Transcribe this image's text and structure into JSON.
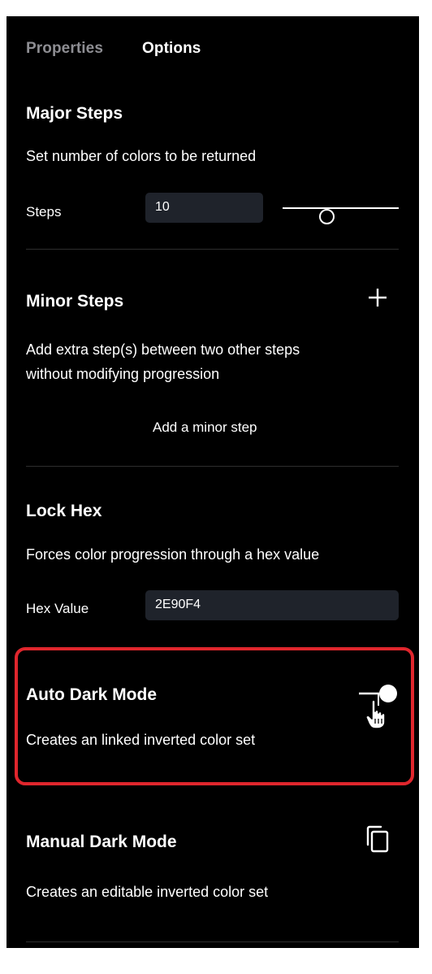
{
  "tabs": [
    {
      "label": "Properties",
      "active": false
    },
    {
      "label": "Options",
      "active": true
    }
  ],
  "major_steps": {
    "title": "Major Steps",
    "description": "Set number of colors to be returned",
    "field_label": "Steps",
    "value": "10",
    "slider_fraction": 0.38
  },
  "minor_steps": {
    "title": "Minor Steps",
    "add_icon": "plus-icon",
    "description_line1": "Add extra step(s) between two other steps",
    "description_line2": "without modifying progression",
    "add_link": "Add a minor step"
  },
  "lock_hex": {
    "title": "Lock Hex",
    "description": "Forces color progression through a hex value",
    "field_label": "Hex Value",
    "value": "2E90F4"
  },
  "auto_dark_mode": {
    "title": "Auto Dark Mode",
    "description": "Creates an linked inverted color set",
    "toggle_on": true,
    "toggle_icon": "toggle-switch-icon",
    "cursor_icon": "hand-pointer-icon",
    "highlight_color": "#e0262d"
  },
  "manual_dark_mode": {
    "title": "Manual Dark Mode",
    "description": "Creates an editable inverted color set",
    "icon": "copy-icon"
  },
  "colors": {
    "panel_bg": "#000000",
    "input_bg": "#1f232b",
    "divider": "#2e2e2e",
    "muted_text": "#8e8e93"
  }
}
